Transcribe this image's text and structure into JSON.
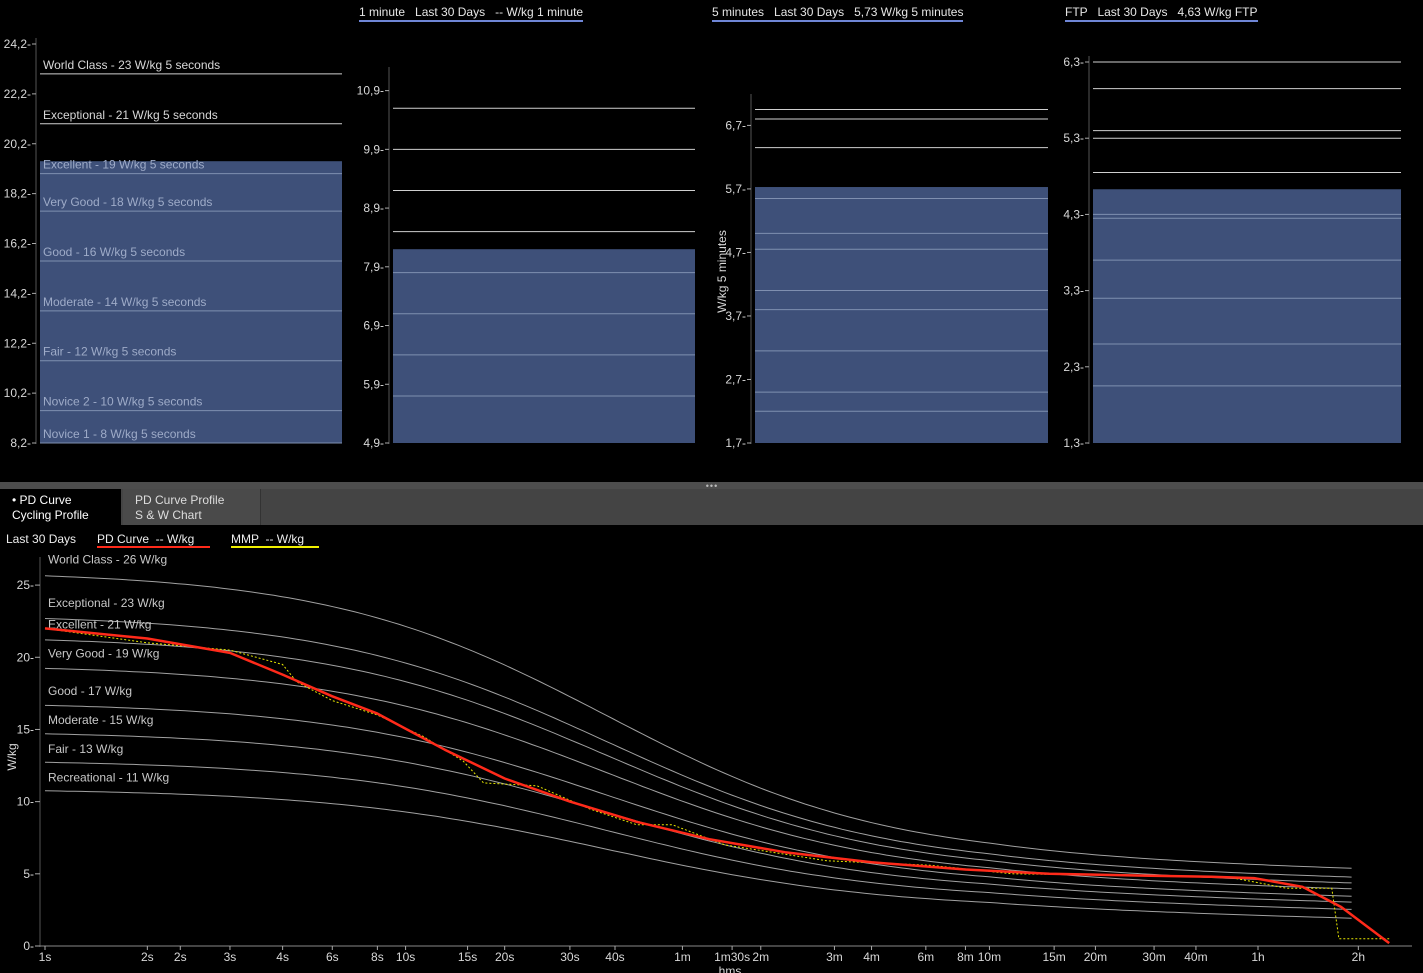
{
  "top_panels": [
    {
      "id": "p5s",
      "title": "",
      "ylabel": "",
      "ylim": [
        8.2,
        24.2
      ],
      "ticks": [
        "24,2",
        "22,2",
        "20,2",
        "18,2",
        "16,2",
        "14,2",
        "12,2",
        "10,2",
        "8,2"
      ],
      "tick_values": [
        24.2,
        22.2,
        20.2,
        18.2,
        16.2,
        14.2,
        12.2,
        10.2,
        8.2
      ],
      "bar_value": 19.5,
      "levels": [
        {
          "label": "World Class - 23 W/kg 5 seconds",
          "value": 23.0
        },
        {
          "label": "Exceptional - 21 W/kg 5 seconds",
          "value": 21.0
        },
        {
          "label": "Excellent - 19 W/kg 5 seconds",
          "value": 19.0
        },
        {
          "label": "Very Good - 18 W/kg 5 seconds",
          "value": 17.5
        },
        {
          "label": "Good - 16 W/kg 5 seconds",
          "value": 15.5
        },
        {
          "label": "Moderate - 14 W/kg 5 seconds",
          "value": 13.5
        },
        {
          "label": "Fair - 12 W/kg 5 seconds",
          "value": 11.5
        },
        {
          "label": "Novice 2 - 10 W/kg 5 seconds",
          "value": 9.5
        },
        {
          "label": "Novice 1 - 8 W/kg 5 seconds",
          "value": 8.2
        }
      ]
    },
    {
      "id": "p1m",
      "title": "1 minute   Last 30 Days   -- W/kg 1 minute",
      "ylabel": "",
      "ylim": [
        4.9,
        11.2
      ],
      "ticks": [
        "10,9",
        "9,9",
        "8,9",
        "7,9",
        "6,9",
        "5,9",
        "4,9"
      ],
      "tick_values": [
        10.9,
        9.9,
        8.9,
        7.9,
        6.9,
        5.9,
        4.9
      ],
      "bar_value": 8.2,
      "levels": [
        {
          "label": "",
          "value": 10.6
        },
        {
          "label": "",
          "value": 9.9
        },
        {
          "label": "",
          "value": 9.2
        },
        {
          "label": "",
          "value": 8.5
        },
        {
          "label": "",
          "value": 7.8
        },
        {
          "label": "",
          "value": 7.1
        },
        {
          "label": "",
          "value": 6.4
        },
        {
          "label": "",
          "value": 5.7
        }
      ]
    },
    {
      "id": "p5m",
      "title": "5 minutes   Last 30 Days   5,73 W/kg 5 minutes",
      "ylabel": "W/kg 5 minutes",
      "ylim": [
        1.7,
        7.1
      ],
      "ticks": [
        "6,7",
        "5,7",
        "4,7",
        "3,7",
        "2,7",
        "1,7"
      ],
      "tick_values": [
        6.7,
        5.7,
        4.7,
        3.7,
        2.7,
        1.7
      ],
      "bar_value": 5.73,
      "levels": [
        {
          "label": "",
          "value": 6.95
        },
        {
          "label": "",
          "value": 6.8
        },
        {
          "label": "",
          "value": 6.35
        },
        {
          "label": "",
          "value": 5.55
        },
        {
          "label": "",
          "value": 5.0
        },
        {
          "label": "",
          "value": 4.75
        },
        {
          "label": "",
          "value": 4.1
        },
        {
          "label": "",
          "value": 3.8
        },
        {
          "label": "",
          "value": 3.15
        },
        {
          "label": "",
          "value": 2.5
        },
        {
          "label": "",
          "value": 2.2
        }
      ]
    },
    {
      "id": "pftp",
      "title": "FTP   Last 30 Days   4,63 W/kg FTP",
      "ylabel": "",
      "ylim": [
        1.3,
        6.3
      ],
      "ticks": [
        "6,3",
        "5,3",
        "4,3",
        "3,3",
        "2,3",
        "1,3"
      ],
      "tick_values": [
        6.3,
        5.3,
        4.3,
        3.3,
        2.3,
        1.3
      ],
      "bar_value": 4.63,
      "levels": [
        {
          "label": "",
          "value": 6.3
        },
        {
          "label": "",
          "value": 5.95
        },
        {
          "label": "",
          "value": 5.4
        },
        {
          "label": "",
          "value": 5.3
        },
        {
          "label": "",
          "value": 4.85
        },
        {
          "label": "",
          "value": 4.3
        },
        {
          "label": "",
          "value": 4.25
        },
        {
          "label": "",
          "value": 3.7
        },
        {
          "label": "",
          "value": 3.2
        },
        {
          "label": "",
          "value": 2.6
        },
        {
          "label": "",
          "value": 2.05
        }
      ]
    }
  ],
  "tabs": [
    {
      "line1": "• PD Curve",
      "line2": "Cycling Profile",
      "active": true
    },
    {
      "line1": "PD Curve Profile",
      "line2": "S & W Chart",
      "active": false
    }
  ],
  "bottom_chart": {
    "legend": {
      "range": "Last 30 Days",
      "pd_curve": "PD Curve  -- W/kg",
      "mmp": "MMP  -- W/kg"
    },
    "colors": {
      "pd_curve": "#ff2a1a",
      "mmp": "#e6e600",
      "levels": "#bdbdbd",
      "bars": "#3e5079"
    },
    "ylabel": "W/kg",
    "xlabel": "hms",
    "ylim": [
      0,
      27.5
    ],
    "y_ticks": [
      "25",
      "20",
      "15",
      "10",
      "5",
      "0"
    ],
    "y_tick_values": [
      25,
      20,
      15,
      10,
      5,
      0
    ],
    "x_ticks": [
      "1s",
      "2s",
      "2s",
      "3s",
      "4s",
      "6s",
      "8s",
      "10s",
      "15s",
      "20s",
      "30s",
      "40s",
      "1m",
      "1m30s",
      "2m",
      "3m",
      "4m",
      "6m",
      "8m",
      "10m",
      "15m",
      "20m",
      "30m",
      "40m",
      "1h",
      "2h"
    ],
    "x_tick_seconds": [
      1,
      2,
      2.5,
      3.5,
      5,
      7,
      9.5,
      11.5,
      17.5,
      22.5,
      35,
      47.5,
      75,
      105,
      127.5,
      210,
      270,
      390,
      510,
      600,
      930,
      1230,
      1830,
      2430,
      3700,
      7300
    ],
    "levels": [
      {
        "label": "World Class - 26 W/kg",
        "plateau": 26.0,
        "tail": 5.9
      },
      {
        "label": "Exceptional - 23 W/kg",
        "plateau": 23.0,
        "tail": 5.3
      },
      {
        "label": "Excellent - 21 W/kg",
        "plateau": 21.5,
        "tail": 4.9
      },
      {
        "label": "Very Good - 19 W/kg",
        "plateau": 19.5,
        "tail": 4.5
      },
      {
        "label": "Good - 17 W/kg",
        "plateau": 16.9,
        "tail": 4.0
      },
      {
        "label": "Moderate - 15 W/kg",
        "plateau": 14.9,
        "tail": 3.6
      },
      {
        "label": "Fair - 13 W/kg",
        "plateau": 12.9,
        "tail": 3.1
      },
      {
        "label": "Recreational - 11 W/kg",
        "plateau": 10.9,
        "tail": 2.5
      }
    ],
    "pd_curve": {
      "x_seconds": [
        1,
        2,
        3.5,
        5,
        7,
        9.5,
        15,
        22.5,
        35,
        55,
        90,
        150,
        270,
        510,
        900,
        1500,
        2700,
        3600,
        5000,
        6500,
        9000
      ],
      "values": [
        22.0,
        21.3,
        20.3,
        18.8,
        17.3,
        16.1,
        13.6,
        11.6,
        10.0,
        8.6,
        7.4,
        6.5,
        5.8,
        5.3,
        5.0,
        4.9,
        4.8,
        4.7,
        4.1,
        2.7,
        0.2
      ]
    },
    "mmp": {
      "x_seconds": [
        1,
        2,
        3.5,
        5,
        5.5,
        7,
        9.5,
        13,
        17,
        19.5,
        28,
        40,
        55,
        70,
        100,
        200,
        400,
        700,
        1500,
        3000,
        4500,
        6100,
        6400,
        9000
      ],
      "values": [
        22.0,
        21.0,
        20.5,
        19.5,
        18.3,
        17.0,
        16.0,
        14.5,
        12.8,
        11.3,
        11.1,
        9.5,
        8.4,
        8.4,
        7.0,
        5.9,
        5.6,
        5.0,
        4.9,
        4.8,
        4.0,
        4.0,
        0.5,
        0.5
      ]
    }
  }
}
